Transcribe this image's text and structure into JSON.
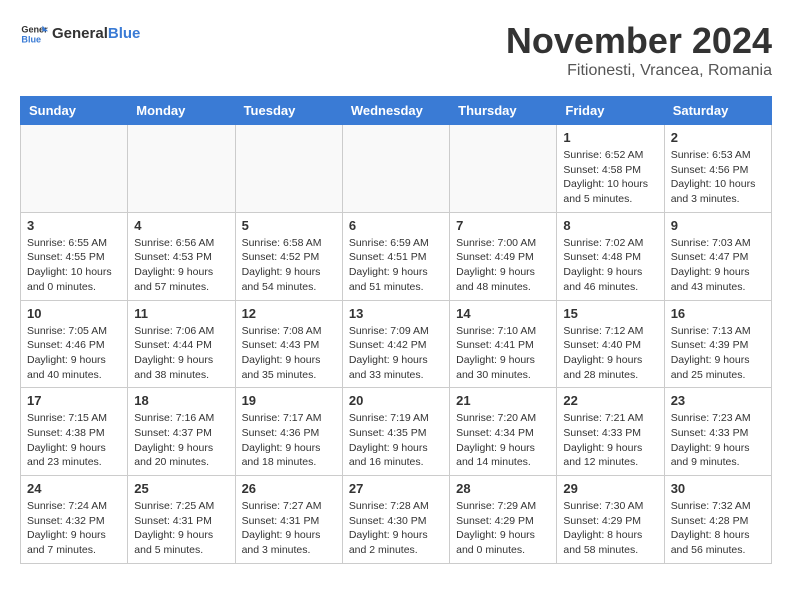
{
  "logo": {
    "text_general": "General",
    "text_blue": "Blue"
  },
  "title": {
    "month": "November 2024",
    "location": "Fitionesti, Vrancea, Romania"
  },
  "weekdays": [
    "Sunday",
    "Monday",
    "Tuesday",
    "Wednesday",
    "Thursday",
    "Friday",
    "Saturday"
  ],
  "weeks": [
    [
      {
        "day": "",
        "info": ""
      },
      {
        "day": "",
        "info": ""
      },
      {
        "day": "",
        "info": ""
      },
      {
        "day": "",
        "info": ""
      },
      {
        "day": "",
        "info": ""
      },
      {
        "day": "1",
        "info": "Sunrise: 6:52 AM\nSunset: 4:58 PM\nDaylight: 10 hours and 5 minutes."
      },
      {
        "day": "2",
        "info": "Sunrise: 6:53 AM\nSunset: 4:56 PM\nDaylight: 10 hours and 3 minutes."
      }
    ],
    [
      {
        "day": "3",
        "info": "Sunrise: 6:55 AM\nSunset: 4:55 PM\nDaylight: 10 hours and 0 minutes."
      },
      {
        "day": "4",
        "info": "Sunrise: 6:56 AM\nSunset: 4:53 PM\nDaylight: 9 hours and 57 minutes."
      },
      {
        "day": "5",
        "info": "Sunrise: 6:58 AM\nSunset: 4:52 PM\nDaylight: 9 hours and 54 minutes."
      },
      {
        "day": "6",
        "info": "Sunrise: 6:59 AM\nSunset: 4:51 PM\nDaylight: 9 hours and 51 minutes."
      },
      {
        "day": "7",
        "info": "Sunrise: 7:00 AM\nSunset: 4:49 PM\nDaylight: 9 hours and 48 minutes."
      },
      {
        "day": "8",
        "info": "Sunrise: 7:02 AM\nSunset: 4:48 PM\nDaylight: 9 hours and 46 minutes."
      },
      {
        "day": "9",
        "info": "Sunrise: 7:03 AM\nSunset: 4:47 PM\nDaylight: 9 hours and 43 minutes."
      }
    ],
    [
      {
        "day": "10",
        "info": "Sunrise: 7:05 AM\nSunset: 4:46 PM\nDaylight: 9 hours and 40 minutes."
      },
      {
        "day": "11",
        "info": "Sunrise: 7:06 AM\nSunset: 4:44 PM\nDaylight: 9 hours and 38 minutes."
      },
      {
        "day": "12",
        "info": "Sunrise: 7:08 AM\nSunset: 4:43 PM\nDaylight: 9 hours and 35 minutes."
      },
      {
        "day": "13",
        "info": "Sunrise: 7:09 AM\nSunset: 4:42 PM\nDaylight: 9 hours and 33 minutes."
      },
      {
        "day": "14",
        "info": "Sunrise: 7:10 AM\nSunset: 4:41 PM\nDaylight: 9 hours and 30 minutes."
      },
      {
        "day": "15",
        "info": "Sunrise: 7:12 AM\nSunset: 4:40 PM\nDaylight: 9 hours and 28 minutes."
      },
      {
        "day": "16",
        "info": "Sunrise: 7:13 AM\nSunset: 4:39 PM\nDaylight: 9 hours and 25 minutes."
      }
    ],
    [
      {
        "day": "17",
        "info": "Sunrise: 7:15 AM\nSunset: 4:38 PM\nDaylight: 9 hours and 23 minutes."
      },
      {
        "day": "18",
        "info": "Sunrise: 7:16 AM\nSunset: 4:37 PM\nDaylight: 9 hours and 20 minutes."
      },
      {
        "day": "19",
        "info": "Sunrise: 7:17 AM\nSunset: 4:36 PM\nDaylight: 9 hours and 18 minutes."
      },
      {
        "day": "20",
        "info": "Sunrise: 7:19 AM\nSunset: 4:35 PM\nDaylight: 9 hours and 16 minutes."
      },
      {
        "day": "21",
        "info": "Sunrise: 7:20 AM\nSunset: 4:34 PM\nDaylight: 9 hours and 14 minutes."
      },
      {
        "day": "22",
        "info": "Sunrise: 7:21 AM\nSunset: 4:33 PM\nDaylight: 9 hours and 12 minutes."
      },
      {
        "day": "23",
        "info": "Sunrise: 7:23 AM\nSunset: 4:33 PM\nDaylight: 9 hours and 9 minutes."
      }
    ],
    [
      {
        "day": "24",
        "info": "Sunrise: 7:24 AM\nSunset: 4:32 PM\nDaylight: 9 hours and 7 minutes."
      },
      {
        "day": "25",
        "info": "Sunrise: 7:25 AM\nSunset: 4:31 PM\nDaylight: 9 hours and 5 minutes."
      },
      {
        "day": "26",
        "info": "Sunrise: 7:27 AM\nSunset: 4:31 PM\nDaylight: 9 hours and 3 minutes."
      },
      {
        "day": "27",
        "info": "Sunrise: 7:28 AM\nSunset: 4:30 PM\nDaylight: 9 hours and 2 minutes."
      },
      {
        "day": "28",
        "info": "Sunrise: 7:29 AM\nSunset: 4:29 PM\nDaylight: 9 hours and 0 minutes."
      },
      {
        "day": "29",
        "info": "Sunrise: 7:30 AM\nSunset: 4:29 PM\nDaylight: 8 hours and 58 minutes."
      },
      {
        "day": "30",
        "info": "Sunrise: 7:32 AM\nSunset: 4:28 PM\nDaylight: 8 hours and 56 minutes."
      }
    ]
  ]
}
